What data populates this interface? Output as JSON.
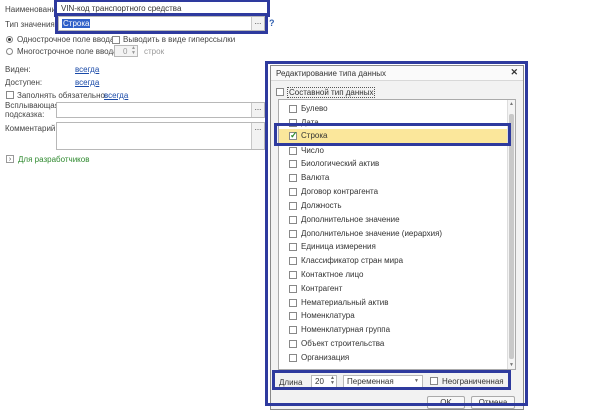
{
  "form": {
    "name_label": "Наименование:",
    "name_value": "VIN-код транспортного средства",
    "type_label": "Тип значения:",
    "type_value": "Строка",
    "type_button": "...",
    "help_icon": "?",
    "single_line": "Однострочное поле ввода",
    "hyperlink": "Выводить в виде гиперссылки",
    "multi_line": "Многострочное поле ввода",
    "multi_count": "0",
    "lines_suffix": "строк",
    "visible_label": "Виден:",
    "visible_value": "всегда",
    "available_label": "Доступен:",
    "available_value": "всегда",
    "required_label": "Заполнять обязательно:",
    "required_value": "всегда",
    "tooltip_label_1": "Всплывающая",
    "tooltip_label_2": "подсказка:",
    "tooltip_button": "...",
    "comment_label": "Комментарий:",
    "comment_button": "...",
    "dev_section": "Для разработчиков"
  },
  "dialog": {
    "title": "Редактирование типа данных",
    "close": "✕",
    "composite": "Составной тип данных",
    "types": [
      {
        "label": "Булево",
        "checked": false
      },
      {
        "label": "Дата",
        "checked": false
      },
      {
        "label": "Строка",
        "checked": true
      },
      {
        "label": "Число",
        "checked": false
      },
      {
        "label": "Биологический актив",
        "checked": false
      },
      {
        "label": "Валюта",
        "checked": false
      },
      {
        "label": "Договор контрагента",
        "checked": false
      },
      {
        "label": "Должность",
        "checked": false
      },
      {
        "label": "Дополнительное значение",
        "checked": false
      },
      {
        "label": "Дополнительное значение (иерархия)",
        "checked": false
      },
      {
        "label": "Единица измерения",
        "checked": false
      },
      {
        "label": "Классификатор стран мира",
        "checked": false
      },
      {
        "label": "Контактное лицо",
        "checked": false
      },
      {
        "label": "Контрагент",
        "checked": false
      },
      {
        "label": "Нематериальный актив",
        "checked": false
      },
      {
        "label": "Номенклатура",
        "checked": false
      },
      {
        "label": "Номенклатурная группа",
        "checked": false
      },
      {
        "label": "Объект строительства",
        "checked": false
      },
      {
        "label": "Организация",
        "checked": false
      }
    ],
    "length_label": "Длина",
    "length_value": "20",
    "variable": "Переменная",
    "unlimited": "Неограниченная",
    "ok": "OK",
    "cancel": "Отмена"
  },
  "colors": {
    "highlight_border": "#2e3a9e",
    "selected_row": "#fbe79b",
    "link": "#1a4aa8",
    "dev_green": "#2f8a2f"
  }
}
